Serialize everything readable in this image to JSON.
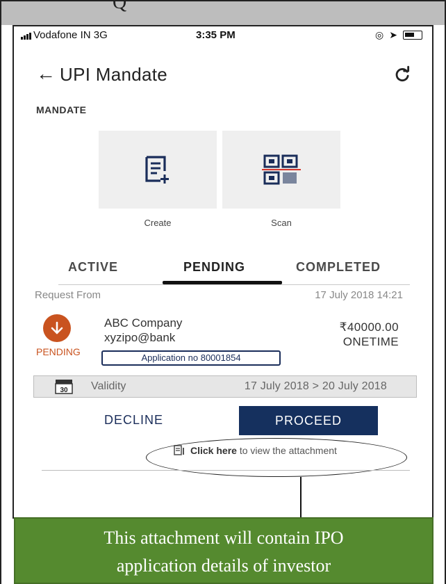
{
  "status_bar": {
    "carrier": "Vodafone IN  3G",
    "time": "3:35 PM"
  },
  "header": {
    "title": "UPI Mandate"
  },
  "section": {
    "label": "MANDATE"
  },
  "actions": [
    {
      "label": "Create",
      "icon": "create-doc-icon"
    },
    {
      "label": "Scan",
      "icon": "qr-scan-icon"
    }
  ],
  "tabs": {
    "active": "ACTIVE",
    "pending": "PENDING",
    "completed": "COMPLETED",
    "selected": "PENDING"
  },
  "request": {
    "from_label": "Request From",
    "date": "17 July 2018 14:21",
    "company": "ABC Company",
    "upi_id": "xyzipo@bank",
    "amount": "₹40000.00",
    "frequency": "ONETIME",
    "status": "PENDING",
    "application_no": "Application no 80001854"
  },
  "validity": {
    "icon_day": "30",
    "label": "Validity",
    "range": "17 July 2018 > 20 July 2018"
  },
  "buttons": {
    "decline": "DECLINE",
    "proceed": "PROCEED"
  },
  "attachment": {
    "link": "Click here",
    "text": " to view the attachment"
  },
  "note": {
    "line1": "This attachment will contain IPO",
    "line2": "application details of investor"
  },
  "colors": {
    "primary": "#15305e",
    "pending": "#c9531f",
    "note_bg": "#558a2f"
  }
}
